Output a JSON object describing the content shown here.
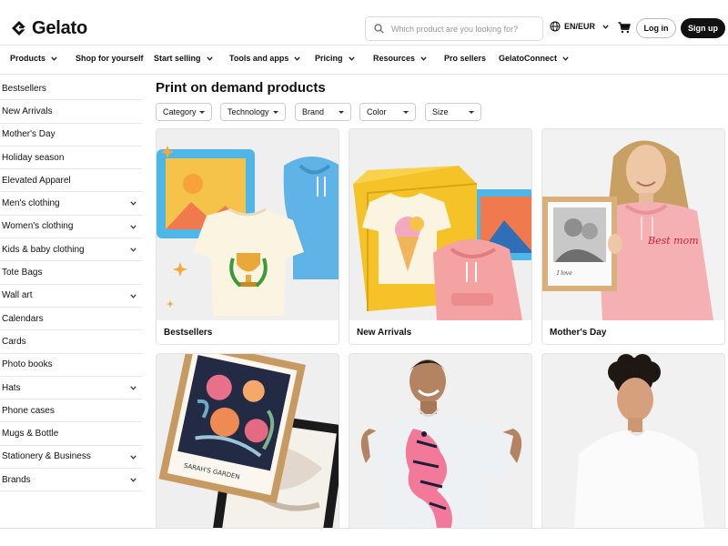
{
  "brand": {
    "name": "Gelato"
  },
  "search": {
    "placeholder": "Which product are you looking for?"
  },
  "locale": {
    "label": "EN/EUR"
  },
  "auth": {
    "login": "Log in",
    "signup": "Sign up"
  },
  "nav": {
    "items": [
      {
        "label": "Products"
      },
      {
        "label": "Shop for yourself"
      },
      {
        "label": "Start selling"
      },
      {
        "label": "Tools and apps"
      },
      {
        "label": "Pricing"
      },
      {
        "label": "Resources"
      },
      {
        "label": "Pro sellers"
      },
      {
        "label": "GelatoConnect"
      }
    ]
  },
  "sidebar": {
    "items": [
      {
        "label": "Bestsellers"
      },
      {
        "label": "New Arrivals"
      },
      {
        "label": "Mother's Day"
      },
      {
        "label": "Holiday season"
      },
      {
        "label": "Elevated Apparel"
      },
      {
        "label": "Men's clothing"
      },
      {
        "label": "Women's clothing"
      },
      {
        "label": "Kids & baby clothing"
      },
      {
        "label": "Tote Bags"
      },
      {
        "label": "Wall art"
      },
      {
        "label": "Calendars"
      },
      {
        "label": "Cards"
      },
      {
        "label": "Photo books"
      },
      {
        "label": "Hats"
      },
      {
        "label": "Phone cases"
      },
      {
        "label": "Mugs & Bottle"
      },
      {
        "label": "Stationery & Business"
      },
      {
        "label": "Brands"
      }
    ]
  },
  "main": {
    "title": "Print on demand products",
    "filters": [
      {
        "label": "Category"
      },
      {
        "label": "Technology"
      },
      {
        "label": "Brand"
      },
      {
        "label": "Color"
      },
      {
        "label": "Size"
      }
    ],
    "cards": [
      {
        "label": "Bestsellers"
      },
      {
        "label": "New Arrivals"
      },
      {
        "label": "Mother's Day"
      },
      {
        "label": ""
      },
      {
        "label": ""
      },
      {
        "label": ""
      }
    ],
    "art": {
      "mom_hoodie_text": "Best mom",
      "garden_poster_text": "SARAH'S GARDEN",
      "photo_caption": "I love"
    }
  },
  "colors": {
    "accent": "#111111",
    "card_bg": "#f1f1f1",
    "border": "#e6e6e6"
  }
}
